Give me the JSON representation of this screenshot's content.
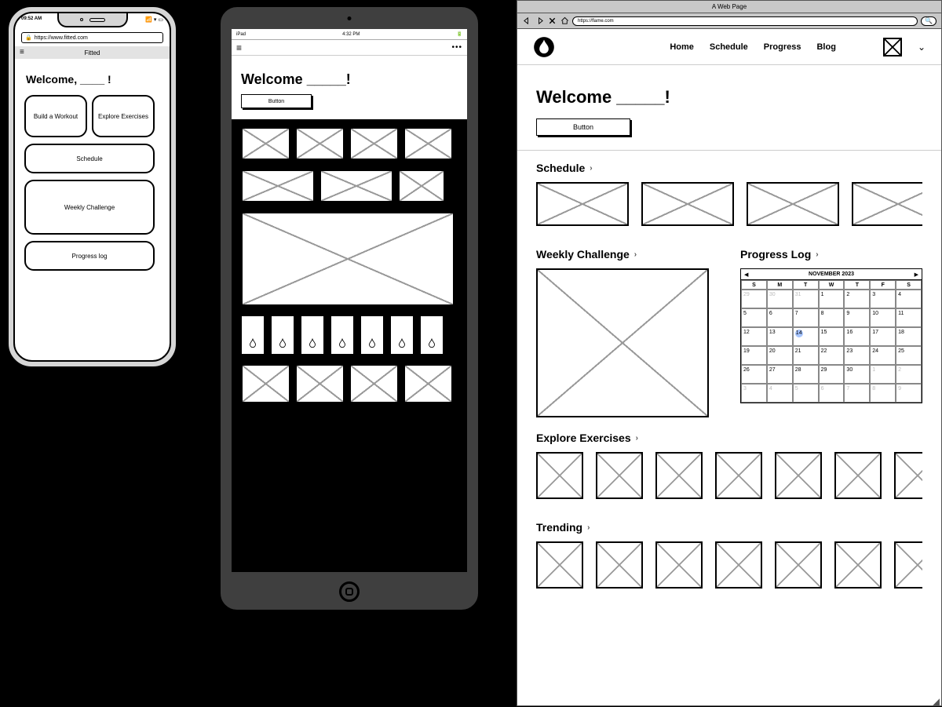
{
  "phone": {
    "status_time": "09:52 AM",
    "url": "https://www.fitted.com",
    "title": "Fitted",
    "welcome": "Welcome, ____ !",
    "cards": {
      "build": "Build a Workout",
      "explore": "Explore Exercises",
      "schedule": "Schedule",
      "weekly": "Weekly Challenge",
      "progress": "Progress log"
    }
  },
  "tablet": {
    "status_left": "iPad",
    "status_time": "4:32 PM",
    "welcome": "Welcome _____!",
    "button": "Button"
  },
  "browser": {
    "window_title": "A Web Page",
    "url": "https://flame.com",
    "nav": {
      "home": "Home",
      "schedule": "Schedule",
      "progress": "Progress",
      "blog": "Blog"
    },
    "welcome": "Welcome _____!",
    "button": "Button",
    "sections": {
      "schedule": "Schedule",
      "weekly": "Weekly Challenge",
      "progress_log": "Progress Log",
      "explore": "Explore Exercises",
      "trending": "Trending"
    },
    "calendar": {
      "month": "NOVEMBER 2023",
      "dow": [
        "S",
        "M",
        "T",
        "W",
        "T",
        "F",
        "S"
      ],
      "cells": [
        {
          "n": "29",
          "dim": true
        },
        {
          "n": "30",
          "dim": true
        },
        {
          "n": "31",
          "dim": true
        },
        {
          "n": "1"
        },
        {
          "n": "2"
        },
        {
          "n": "3"
        },
        {
          "n": "4"
        },
        {
          "n": "5"
        },
        {
          "n": "6"
        },
        {
          "n": "7"
        },
        {
          "n": "8"
        },
        {
          "n": "9"
        },
        {
          "n": "10"
        },
        {
          "n": "11"
        },
        {
          "n": "12"
        },
        {
          "n": "13"
        },
        {
          "n": "14",
          "today": true
        },
        {
          "n": "15"
        },
        {
          "n": "16"
        },
        {
          "n": "17"
        },
        {
          "n": "18"
        },
        {
          "n": "19"
        },
        {
          "n": "20"
        },
        {
          "n": "21"
        },
        {
          "n": "22"
        },
        {
          "n": "23"
        },
        {
          "n": "24"
        },
        {
          "n": "25"
        },
        {
          "n": "26"
        },
        {
          "n": "27"
        },
        {
          "n": "28"
        },
        {
          "n": "29"
        },
        {
          "n": "30"
        },
        {
          "n": "1",
          "dim": true
        },
        {
          "n": "2",
          "dim": true
        },
        {
          "n": "3",
          "dim": true
        },
        {
          "n": "4",
          "dim": true
        },
        {
          "n": "5",
          "dim": true
        },
        {
          "n": "6",
          "dim": true
        },
        {
          "n": "7",
          "dim": true
        },
        {
          "n": "8",
          "dim": true
        },
        {
          "n": "9",
          "dim": true
        }
      ]
    }
  }
}
